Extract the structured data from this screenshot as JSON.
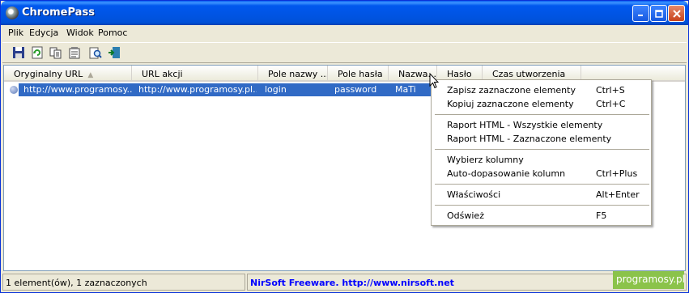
{
  "window": {
    "title": "ChromePass"
  },
  "menu": [
    "Plik",
    "Edycja",
    "Widok",
    "Pomoc"
  ],
  "columns": [
    {
      "label": "Oryginalny URL"
    },
    {
      "label": "URL akcji"
    },
    {
      "label": "Pole nazwy ..."
    },
    {
      "label": "Pole hasła"
    },
    {
      "label": "Nazwa..."
    },
    {
      "label": "Hasło"
    },
    {
      "label": "Czas utworzenia"
    }
  ],
  "rows": [
    {
      "cells": [
        "http://www.programosy....",
        "http://www.programosy.pl....",
        "login",
        "password",
        "MaTi",
        "",
        ""
      ]
    }
  ],
  "context_menu": {
    "items": [
      {
        "label": "Zapisz zaznaczone elementy",
        "shortcut": "Ctrl+S"
      },
      {
        "label": "Kopiuj zaznaczone elementy",
        "shortcut": "Ctrl+C"
      },
      {
        "label": "Raport HTML - Wszystkie elementy",
        "shortcut": ""
      },
      {
        "label": "Raport HTML - Zaznaczone elementy",
        "shortcut": ""
      },
      {
        "label": "Wybierz kolumny",
        "shortcut": ""
      },
      {
        "label": "Auto-dopasowanie kolumn",
        "shortcut": "Ctrl+Plus"
      },
      {
        "label": "Właściwości",
        "shortcut": "Alt+Enter"
      },
      {
        "label": "Odśwież",
        "shortcut": "F5"
      }
    ]
  },
  "status": {
    "count": "1 element(ów), 1 zaznaczonych",
    "nirsoft": "NirSoft Freeware.  http://www.nirsoft.net",
    "badge": "programosy.pl"
  },
  "colors": {
    "selection": "#316AC5",
    "title_bar": "#0054E3",
    "nirsoft_link": "#0000FF",
    "badge_bg": "#8BC34A"
  },
  "icons": [
    "save-icon",
    "refresh-icon",
    "copy-icon",
    "properties-icon",
    "find-icon",
    "exit-icon"
  ]
}
